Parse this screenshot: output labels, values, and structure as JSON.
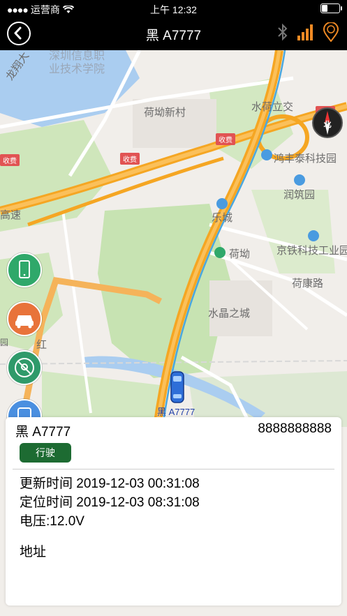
{
  "status_bar": {
    "carrier": "运营商",
    "time": "上午 12:32"
  },
  "nav": {
    "title": "黑 A7777",
    "icons": [
      "bluetooth-icon",
      "signal-bars-icon",
      "gps-location-icon"
    ],
    "colors": {
      "background": "#000000",
      "signal": "#f08a24",
      "gps": "#f08a24"
    }
  },
  "map": {
    "labels": [
      {
        "text": "深圳信息职",
        "cls": "faint"
      },
      {
        "text": "业技术学院",
        "cls": "faint"
      },
      {
        "text": "荷坳新村",
        "cls": ""
      },
      {
        "text": "水荷立交",
        "cls": ""
      },
      {
        "text": "鸿丰泰科技园",
        "cls": ""
      },
      {
        "text": "润筑园",
        "cls": ""
      },
      {
        "text": "乐城",
        "cls": ""
      },
      {
        "text": "荷坳",
        "cls": ""
      },
      {
        "text": "京铁科技工业园",
        "cls": ""
      },
      {
        "text": "荷康路",
        "cls": ""
      },
      {
        "text": "水晶之城",
        "cls": ""
      },
      {
        "text": "高速",
        "cls": ""
      },
      {
        "text": "龙翔大",
        "cls": ""
      },
      {
        "text": "红",
        "cls": ""
      },
      {
        "text": "园",
        "cls": ""
      }
    ],
    "toll_label": "收费",
    "compass_label": "北",
    "car_label": "黑 A7777",
    "side_buttons": [
      {
        "name": "phone-button",
        "icon": "phone-icon",
        "color": "#2fa86a"
      },
      {
        "name": "car-button",
        "icon": "car-icon",
        "color": "#e8733a"
      },
      {
        "name": "fence-button",
        "icon": "no-location-icon",
        "color": "#2f9a6a"
      },
      {
        "name": "bus-button",
        "icon": "bus-icon",
        "color": "#4a8fe0"
      }
    ]
  },
  "info": {
    "plate": "黑 A7777",
    "phone": "8888888888",
    "status": "行驶",
    "updated": "更新时间 2019-12-03 00:31:08",
    "located": "定位时间 2019-12-03 08:31:08",
    "voltage": "电压:12.0V",
    "address": "地址"
  }
}
